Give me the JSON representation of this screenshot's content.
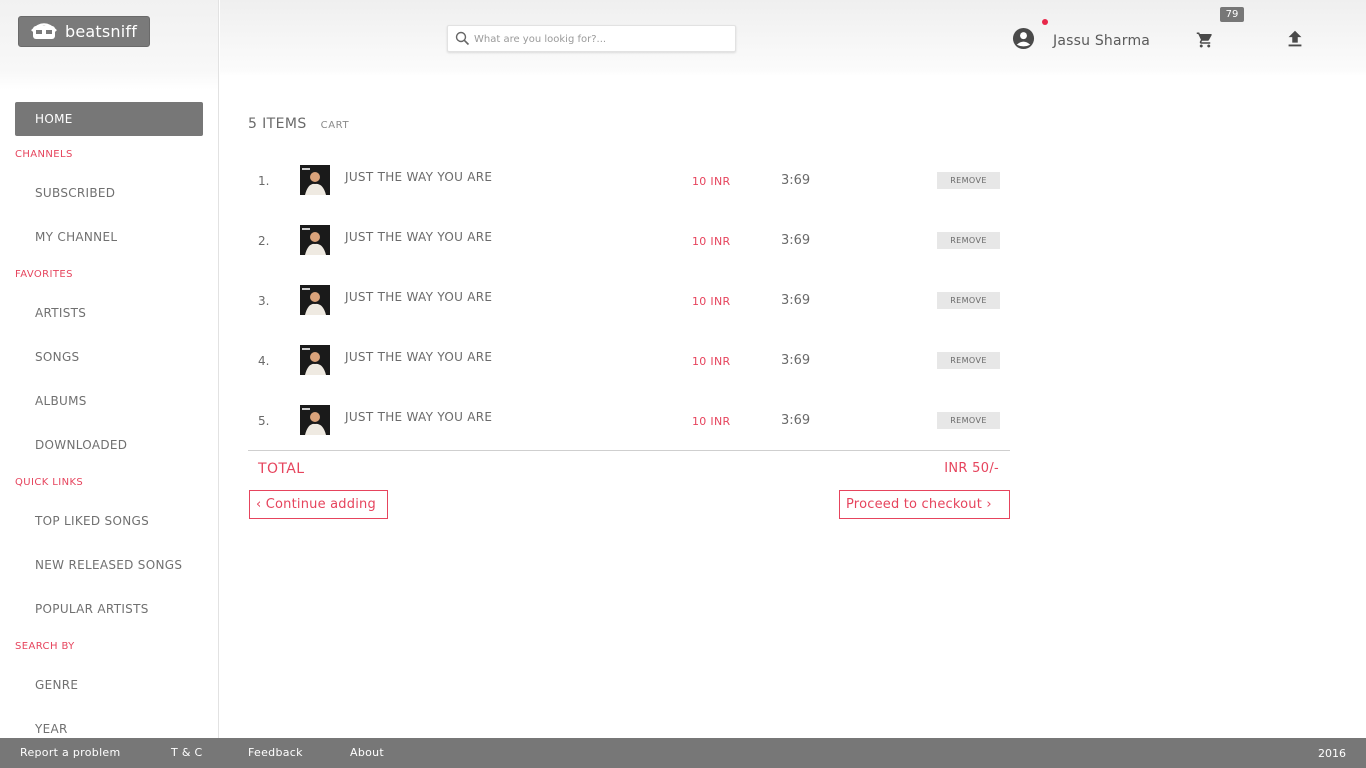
{
  "app": {
    "logo_text": "beatsniff"
  },
  "header": {
    "search_placeholder": "What are you lookig for?...",
    "user_name": "Jassu Sharma",
    "cart_count": "79"
  },
  "sidebar": {
    "home": "HOME",
    "sections": [
      {
        "title": "CHANNELS",
        "items": [
          "SUBSCRIBED",
          "MY CHANNEL"
        ]
      },
      {
        "title": "FAVORITES",
        "items": [
          "ARTISTS",
          "SONGS",
          "ALBUMS",
          "DOWNLOADED"
        ]
      },
      {
        "title": "QUICK LINKS",
        "items": [
          "TOP LIKED SONGS",
          "NEW RELEASED SONGS",
          "POPULAR ARTISTS"
        ]
      },
      {
        "title": "SEARCH BY",
        "items": [
          "GENRE",
          "YEAR"
        ]
      }
    ]
  },
  "cart": {
    "count_label": "5 ITEMS",
    "label": "CART",
    "items": [
      {
        "index": "1.",
        "title": "JUST THE WAY YOU ARE",
        "price": "10 INR",
        "duration": "3:69",
        "remove_label": "REMOVE"
      },
      {
        "index": "2.",
        "title": "JUST THE WAY YOU ARE",
        "price": "10 INR",
        "duration": "3:69",
        "remove_label": "REMOVE"
      },
      {
        "index": "3.",
        "title": "JUST THE WAY YOU ARE",
        "price": "10 INR",
        "duration": "3:69",
        "remove_label": "REMOVE"
      },
      {
        "index": "4.",
        "title": "JUST THE WAY YOU ARE",
        "price": "10 INR",
        "duration": "3:69",
        "remove_label": "REMOVE"
      },
      {
        "index": "5.",
        "title": "JUST THE WAY YOU ARE",
        "price": "10 INR",
        "duration": "3:69",
        "remove_label": "REMOVE"
      }
    ],
    "total_label": "TOTAL",
    "total_value": "INR 50/-",
    "continue_label": "‹ Continue adding",
    "checkout_label": "Proceed to checkout ›"
  },
  "footer": {
    "links": [
      "Report a problem",
      "T & C",
      "Feedback",
      "About"
    ],
    "year": "2016"
  },
  "colors": {
    "accent": "#e6445d",
    "dark_gray": "#777777"
  }
}
